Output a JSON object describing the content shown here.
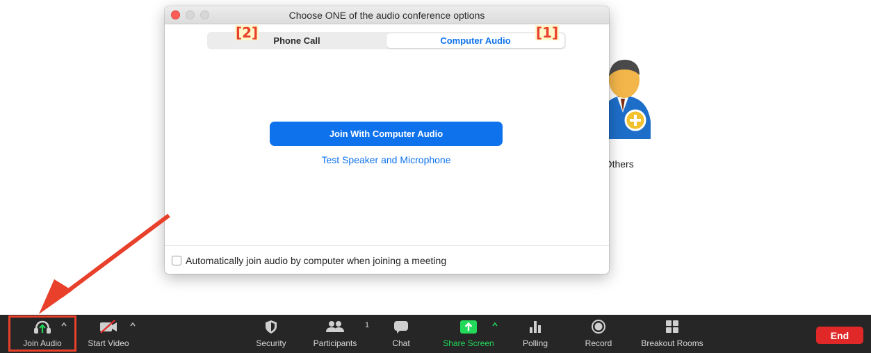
{
  "dialog": {
    "title": "Choose ONE of the audio conference options",
    "tabs": [
      {
        "label": "Phone Call",
        "selected": false
      },
      {
        "label": "Computer Audio",
        "selected": true
      }
    ],
    "markers": {
      "phone": "[2]",
      "computer": "[1]"
    },
    "join_button": "Join With Computer Audio",
    "test_link": "Test Speaker and Microphone",
    "auto_join_label": "Automatically join audio by computer when joining a meeting",
    "auto_join_checked": false
  },
  "background": {
    "invite_label": "e Others"
  },
  "toolbar": {
    "join_audio": "Join Audio",
    "start_video": "Start Video",
    "security": "Security",
    "participants": "Participants",
    "participants_count": "1",
    "chat": "Chat",
    "share_screen": "Share Screen",
    "polling": "Polling",
    "record": "Record",
    "breakout_rooms": "Breakout Rooms",
    "end": "End"
  },
  "colors": {
    "accent_blue": "#0e72ed",
    "share_green": "#23d959",
    "toolbar_bg": "#262626",
    "end_red": "#e02828",
    "annotation_red": "#e8402a"
  },
  "icons": {
    "join_audio": "headphones-icon",
    "start_video": "video-off-icon",
    "security": "shield-icon",
    "participants": "people-icon",
    "chat": "chat-bubble-icon",
    "share_screen": "share-up-arrow-icon",
    "polling": "bar-chart-icon",
    "record": "record-circle-icon",
    "breakout_rooms": "grid-icon"
  }
}
